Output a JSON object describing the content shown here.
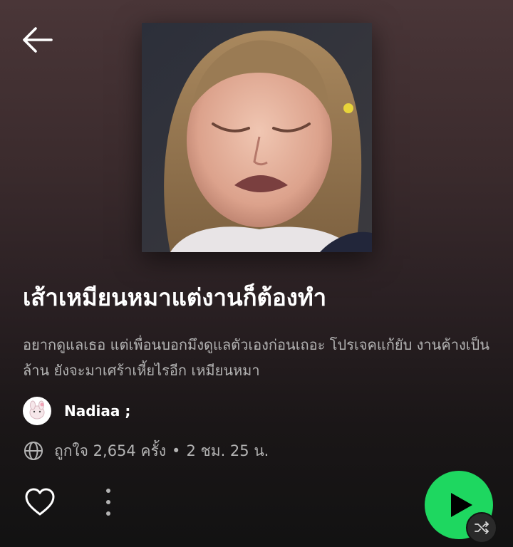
{
  "playlist": {
    "title": "เส้าเหมียนหมาแต่งานก็ต้องทำ",
    "description": "อยากดูแลเธอ แต่เพื่อนบอกมึงดูแลตัวเองก่อนเถอะ โปรเจคแก้ยับ งานค้างเป็นล้าน ยังจะมาเศร้าเหี้ยไรอีก เหมียนหมา",
    "owner": "Nadiaa ;",
    "likes": "ถูกใจ 2,654 ครั้ง",
    "separator": "•",
    "duration": "2 ชม. 25 น."
  },
  "icons": {
    "back": "arrow-left-icon",
    "globe": "globe-icon",
    "like": "heart-outline-icon",
    "more": "more-vertical-icon",
    "play": "play-icon",
    "shuffle": "shuffle-icon"
  },
  "colors": {
    "accent": "#1ed760",
    "background_top": "#4a3638",
    "background_bottom": "#121212",
    "secondary_text": "#b3b3b3"
  }
}
